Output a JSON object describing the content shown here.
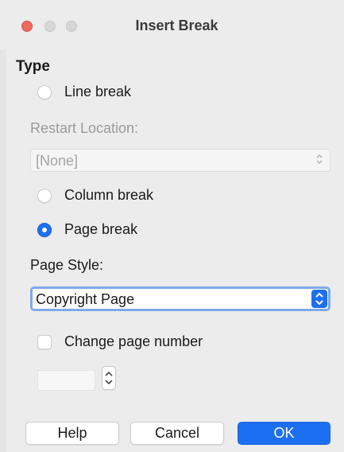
{
  "window": {
    "title": "Insert Break"
  },
  "type_heading": "Type",
  "options": {
    "line_break": {
      "label": "Line break",
      "checked": false
    },
    "column_break": {
      "label": "Column break",
      "checked": false
    },
    "page_break": {
      "label": "Page break",
      "checked": true
    }
  },
  "restart_location": {
    "label": "Restart Location:",
    "value": "[None]",
    "enabled": false
  },
  "page_style": {
    "label": "Page Style:",
    "value": "Copyright Page"
  },
  "change_page_number": {
    "label": "Change page number",
    "checked": false,
    "value": ""
  },
  "buttons": {
    "help": "Help",
    "cancel": "Cancel",
    "ok": "OK"
  },
  "colors": {
    "accent": "#1d6ff2",
    "close": "#ec6a5e",
    "focus_ring": "#7ea9ec"
  },
  "icons": {
    "select_chevron": "chevron-up-down-icon",
    "spinner": "chevron-up-down-icon"
  }
}
